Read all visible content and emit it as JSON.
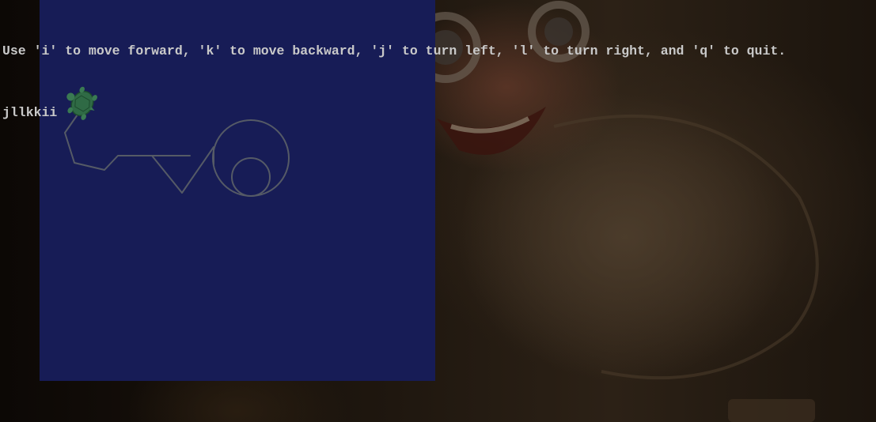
{
  "terminal": {
    "instructions": "Use 'i' to move forward, 'k' to move backward, 'j' to turn left, 'l' to turn right, and 'q' to quit.",
    "input_echo": "jllkkii"
  },
  "turtle_canvas": {
    "background_color": "#171c56",
    "pen_color": "#555a66",
    "turtle_color": "#2f6a45",
    "turtle_icon": "turtle-icon"
  },
  "wallpaper": {
    "description_icon": "wallpaper-image"
  }
}
